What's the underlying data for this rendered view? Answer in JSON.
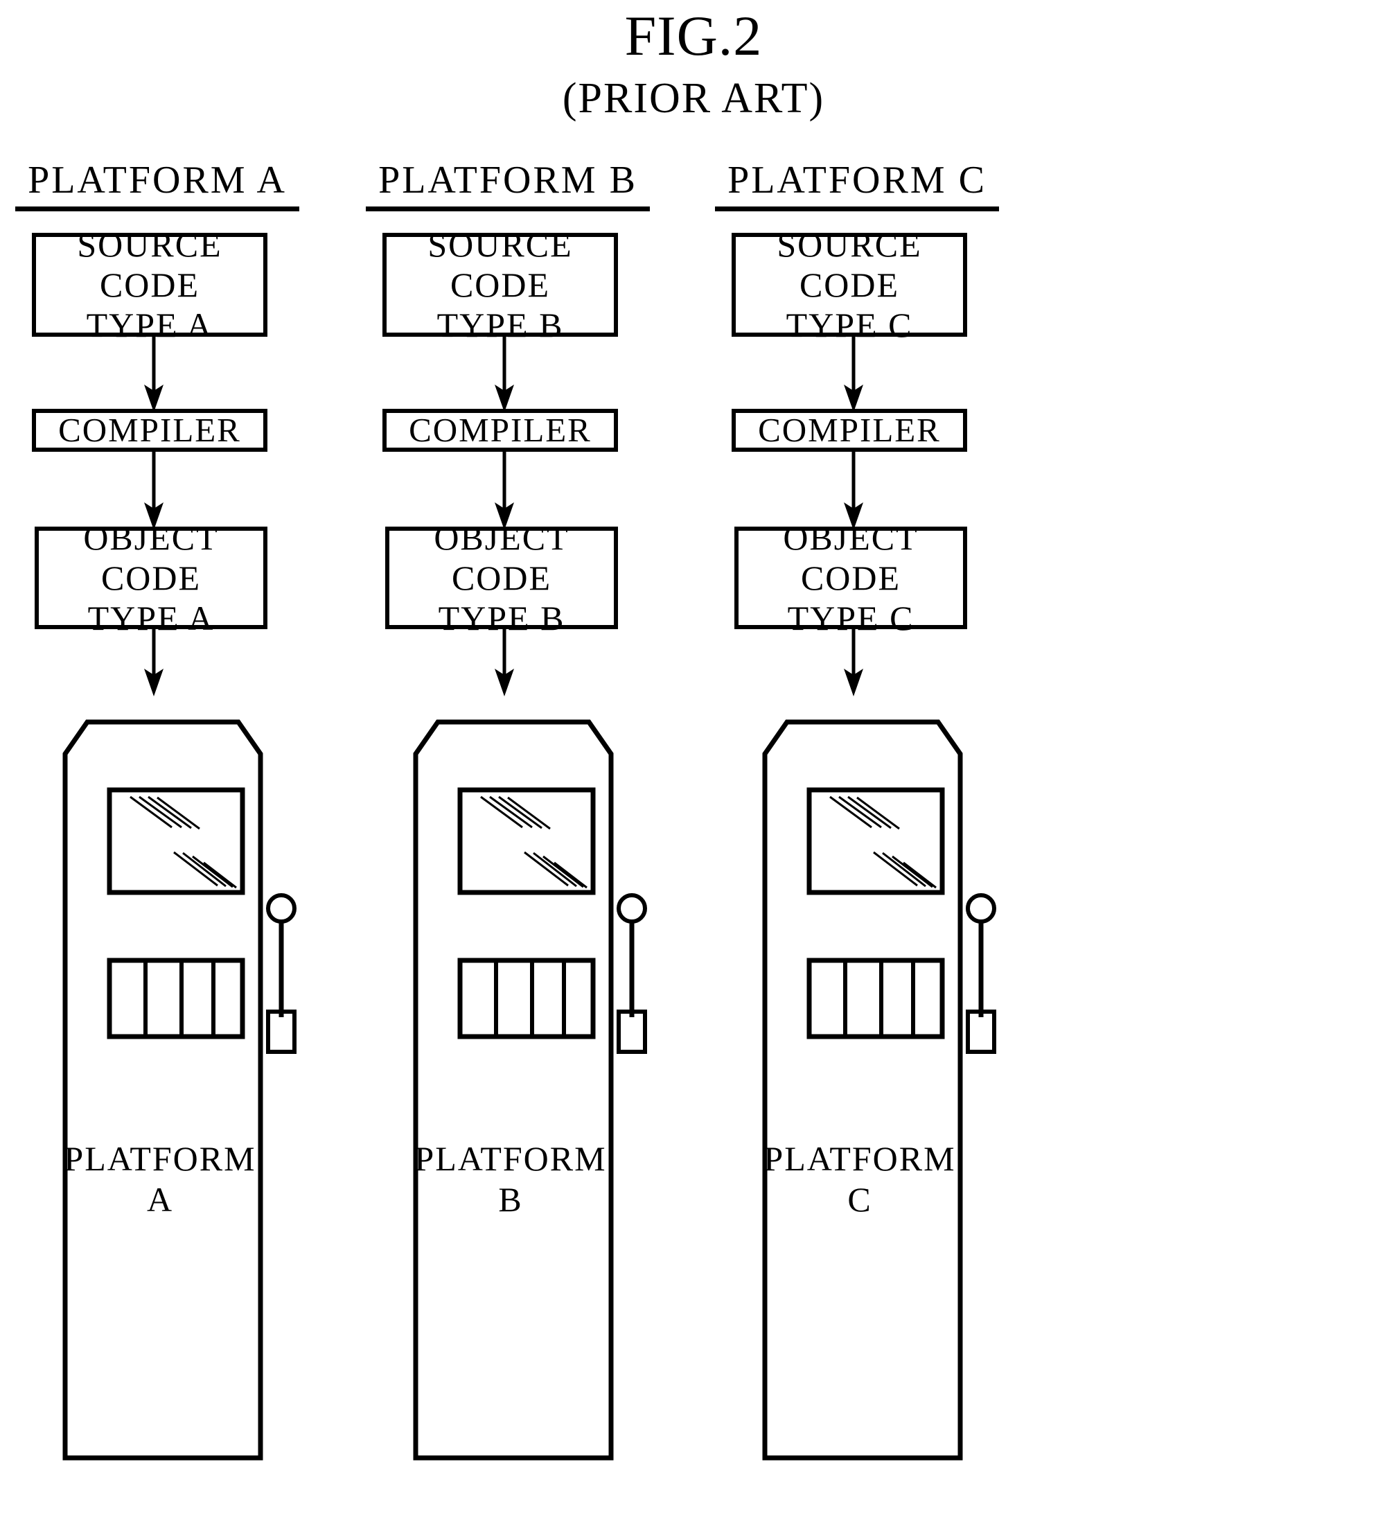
{
  "figure": {
    "title": "FIG.2",
    "subtitle": "(PRIOR ART)"
  },
  "style": {
    "ink": "#000000",
    "paper": "#ffffff"
  },
  "columns": [
    {
      "heading": "PLATFORM  A",
      "source_box": {
        "line1": "SOURCE",
        "line2": "CODE",
        "line3": "TYPE  A"
      },
      "compiler_box": {
        "label": "COMPILER"
      },
      "object_box": {
        "line1": "OBJECT",
        "line2": "CODE",
        "line3": "TYPE  A"
      },
      "device": {
        "line1": "PLATFORM",
        "line2": "A"
      }
    },
    {
      "heading": "PLATFORM  B",
      "source_box": {
        "line1": "SOURCE",
        "line2": "CODE",
        "line3": "TYPE  B"
      },
      "compiler_box": {
        "label": "COMPILER"
      },
      "object_box": {
        "line1": "OBJECT",
        "line2": "CODE",
        "line3": "TYPE  B"
      },
      "device": {
        "line1": "PLATFORM",
        "line2": "B"
      }
    },
    {
      "heading": "PLATFORM  C",
      "source_box": {
        "line1": "SOURCE",
        "line2": "CODE",
        "line3": "TYPE  C"
      },
      "compiler_box": {
        "label": "COMPILER"
      },
      "object_box": {
        "line1": "OBJECT",
        "line2": "CODE",
        "line3": "TYPE  C"
      },
      "device": {
        "line1": "PLATFORM",
        "line2": "C"
      }
    }
  ],
  "diagram": {
    "type": "flowchart",
    "description": "Three parallel compilation pipelines, one per platform. Each pipeline: source code of a platform-specific type, compiled by a compiler, producing object code of that same platform-specific type, which is then loaded onto the corresponding platform device.",
    "flow_steps": [
      "SOURCE CODE TYPE",
      "COMPILER",
      "OBJECT CODE TYPE",
      "PLATFORM"
    ],
    "arrow_count_per_column": 3,
    "device_parts": [
      "screen",
      "keypad",
      "antenna"
    ],
    "keypad_cells": 4
  }
}
